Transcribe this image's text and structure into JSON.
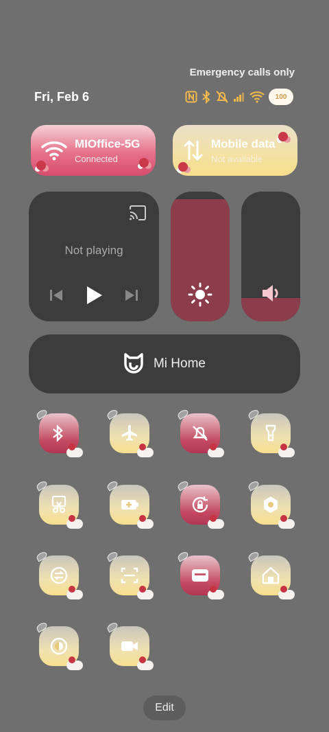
{
  "status": {
    "carrier_text": "Emergency calls only",
    "date": "Fri, Feb 6",
    "battery": "100",
    "icons": [
      "nfc-icon",
      "bluetooth-icon",
      "mute-icon",
      "signal-icon",
      "wifi-icon",
      "battery-icon"
    ]
  },
  "connections": {
    "wifi": {
      "title": "MIOffice-5G",
      "subtitle": "Connected",
      "state": "on",
      "icon": "wifi-icon"
    },
    "mobile_data": {
      "title": "Mobile data",
      "subtitle": "Not available",
      "state": "off",
      "icon": "mobile-data-icon"
    }
  },
  "media": {
    "status": "Not playing",
    "icons": [
      "cast-icon",
      "previous-icon",
      "play-icon",
      "next-icon"
    ]
  },
  "sliders": {
    "brightness": {
      "level": 0.94,
      "icon": "brightness-icon"
    },
    "volume": {
      "level": 0.18,
      "icon": "volume-icon"
    }
  },
  "mi_home": {
    "label": "Mi Home"
  },
  "toggles": [
    {
      "name": "bluetooth",
      "icon": "bluetooth-icon",
      "state": "on"
    },
    {
      "name": "airplane-mode",
      "icon": "airplane-icon",
      "state": "off"
    },
    {
      "name": "mute",
      "icon": "bell-off-icon",
      "state": "on"
    },
    {
      "name": "flashlight",
      "icon": "flashlight-icon",
      "state": "off"
    },
    {
      "name": "screenshot",
      "icon": "scissors-icon",
      "state": "off"
    },
    {
      "name": "battery-saver",
      "icon": "battery-plus-icon",
      "state": "off"
    },
    {
      "name": "rotation-lock",
      "icon": "rotation-lock-icon",
      "state": "on"
    },
    {
      "name": "settings",
      "icon": "hexagon-settings-icon",
      "state": "off"
    },
    {
      "name": "data-saver",
      "icon": "sync-icon",
      "state": "off"
    },
    {
      "name": "scanner",
      "icon": "scan-icon",
      "state": "off"
    },
    {
      "name": "cards",
      "icon": "card-icon",
      "state": "on"
    },
    {
      "name": "home",
      "icon": "home-icon",
      "state": "off"
    },
    {
      "name": "reading-mode",
      "icon": "contrast-icon",
      "state": "off"
    },
    {
      "name": "screen-recorder",
      "icon": "video-camera-icon",
      "state": "off"
    }
  ],
  "edit_label": "Edit",
  "colors": {
    "background": "#6f6f6f",
    "panel": "#3c3c3c",
    "active_pink": "#c34860",
    "inactive_cream": "#f7df8f",
    "slider_fill": "#8b3d4b",
    "status_icon_yellow": "#f2b84b"
  }
}
